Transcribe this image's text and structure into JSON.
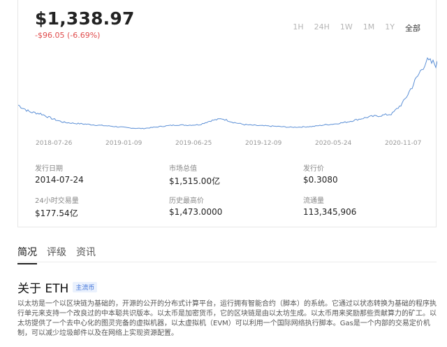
{
  "header": {
    "price": "$1,338.97",
    "change": "-$96.05 (-6.69%)"
  },
  "ranges": [
    "1H",
    "24H",
    "1W",
    "1M",
    "1Y",
    "全部"
  ],
  "active_range": "全部",
  "chart_data": {
    "type": "line",
    "x_tick_labels": [
      "2018-07-26",
      "2019-01-09",
      "2019-06-25",
      "2019-12-09",
      "2020-05-24",
      "2020-11-07"
    ],
    "series": [
      {
        "values": [
          560,
          430,
          395,
          300,
          230,
          210,
          195,
          175,
          160,
          140,
          120,
          110,
          135,
          160,
          180,
          175,
          185,
          260,
          300,
          230,
          185,
          170,
          160,
          150,
          135,
          140,
          150,
          180,
          200,
          235,
          285,
          335,
          360,
          390,
          610,
          1000,
          1400,
          1339
        ]
      }
    ],
    "line_color": "#5b8fd6",
    "grid": false
  },
  "stats": [
    {
      "label": "发行日期",
      "value": "2014-07-24"
    },
    {
      "label": "市场总值",
      "value": "$1,515.00亿"
    },
    {
      "label": "发行价",
      "value": "$0.3080"
    },
    {
      "label": "24小时交易量",
      "value": "$177.54亿"
    },
    {
      "label": "历史最高价",
      "value": "$1,473.0000"
    },
    {
      "label": "流通量",
      "value": "113,345,906"
    }
  ],
  "tabs": [
    "简况",
    "评级",
    "资讯"
  ],
  "about": {
    "title": "关于 ETH",
    "badge": "主流币",
    "description": "以太坊是一个以区块链为基础的，开源的公开的分布式计算平台，运行拥有智能合约（脚本）的系统。它通过以状态转换为基础的程序执行单元来支持一个改良过的中本聪共识版本。以太币是加密货币，它的区块链是由以太坊生成。以太币用来奖励那些贡献算力的矿工。以太坊提供了一个去中心化的图灵完备的虚拟机器，以太虚拟机（EVM）可以利用一个国际网络执行脚本。Gas是一个内部的交易定价机制，可以减少垃圾邮件以及在网络上实现资源配置。"
  }
}
